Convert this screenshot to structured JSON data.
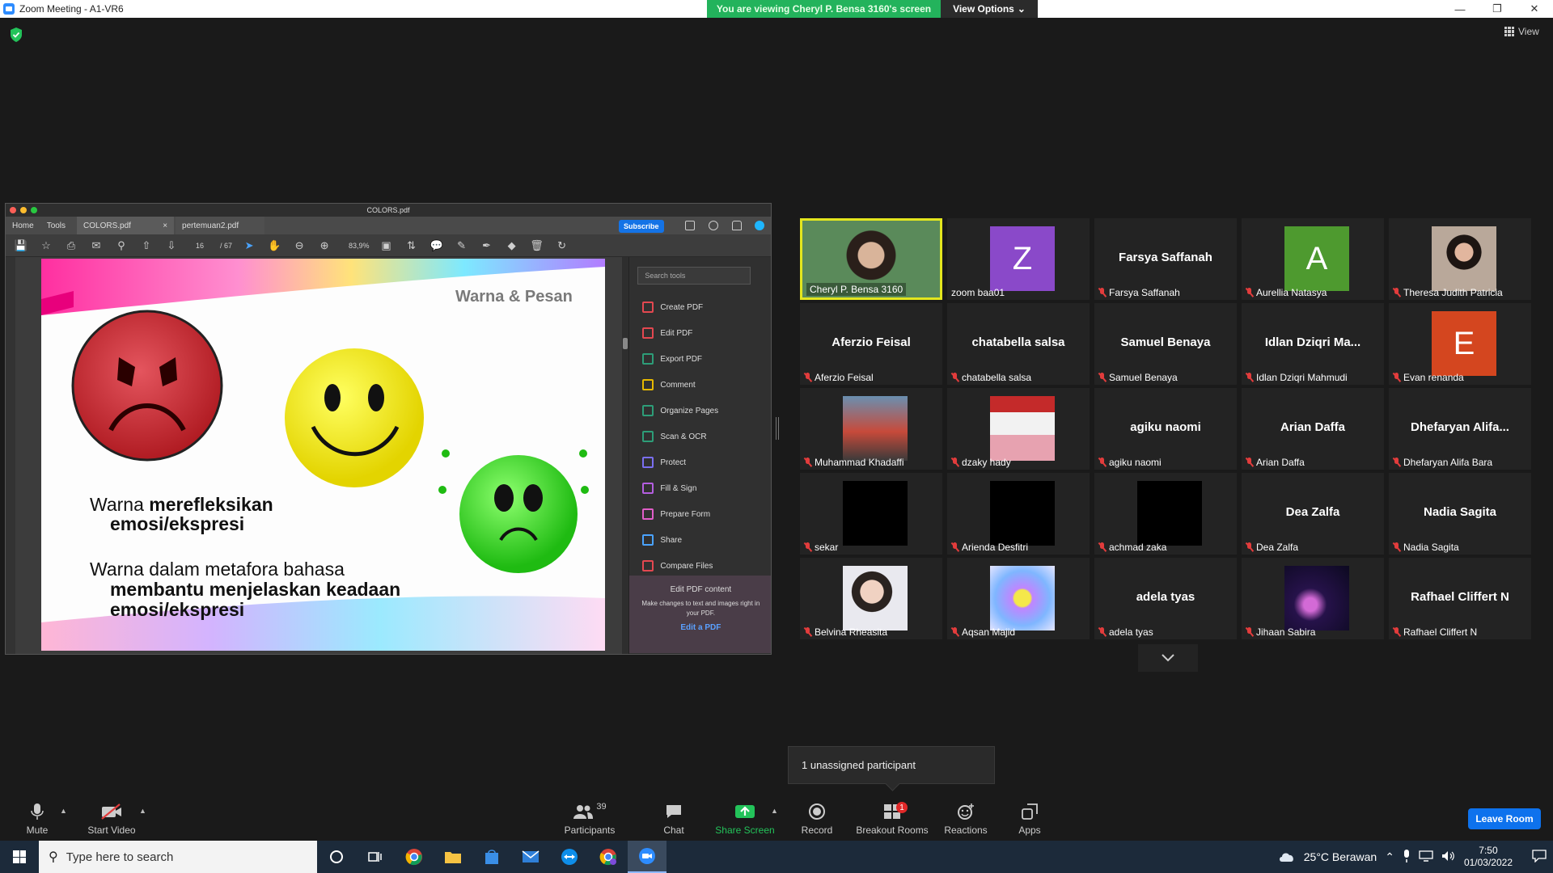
{
  "window": {
    "title": "Zoom Meeting - A1-VR6"
  },
  "banner": {
    "viewing": "You are viewing Cheryl P. Bensa 3160's screen",
    "view_options": "View Options"
  },
  "view_button": "View",
  "acrobat": {
    "title": "COLORS.pdf",
    "menu": [
      "Home",
      "Tools"
    ],
    "tabs": [
      "COLORS.pdf",
      "pertemuan2.pdf"
    ],
    "subscribe": "Subscribe",
    "page_current": "16",
    "page_total": "/ 67",
    "zoom": "83,9%",
    "search_placeholder": "Search tools",
    "tools": [
      {
        "label": "Create PDF",
        "color": "#e34850"
      },
      {
        "label": "Edit PDF",
        "color": "#e34850"
      },
      {
        "label": "Export PDF",
        "color": "#2d9d78"
      },
      {
        "label": "Comment",
        "color": "#e6b800"
      },
      {
        "label": "Organize Pages",
        "color": "#2d9d78"
      },
      {
        "label": "Scan & OCR",
        "color": "#2d9d78"
      },
      {
        "label": "Protect",
        "color": "#7a6ff0"
      },
      {
        "label": "Fill & Sign",
        "color": "#b45ee0"
      },
      {
        "label": "Prepare Form",
        "color": "#e05ec8"
      },
      {
        "label": "Share",
        "color": "#4aa3ff"
      },
      {
        "label": "Compare Files",
        "color": "#e34850"
      }
    ],
    "promo": {
      "heading": "Edit PDF content",
      "body": "Make changes to text and images right in your PDF.",
      "link": "Edit a PDF"
    }
  },
  "slide": {
    "title": "Warna & Pesan",
    "line1a": "Warna ",
    "line1b": "merefleksikan",
    "line2": "emosi/ekspresi",
    "line3": "Warna dalam metafora bahasa",
    "line4": "membantu menjelaskan keadaan",
    "line5": "emosi/ekspresi"
  },
  "participants": [
    {
      "label": "Cheryl P. Bensa 3160",
      "kind": "photo",
      "muted": false,
      "active": true
    },
    {
      "label": "zoom baa01",
      "kind": "avatar",
      "letter": "Z",
      "color": "#8a49c9",
      "muted": false
    },
    {
      "label": "Farsya Saffanah",
      "kind": "name",
      "name": "Farsya Saffanah",
      "muted": true
    },
    {
      "label": "Aurellia Natasya",
      "kind": "avatar",
      "letter": "A",
      "color": "#4e9a2f",
      "muted": true
    },
    {
      "label": "Theresa Judith Patricia",
      "kind": "photo",
      "muted": true
    },
    {
      "label": "Aferzio Feisal",
      "kind": "name",
      "name": "Aferzio Feisal",
      "muted": true
    },
    {
      "label": "chatabella salsa",
      "kind": "name",
      "name": "chatabella salsa",
      "muted": true
    },
    {
      "label": "Samuel Benaya",
      "kind": "name",
      "name": "Samuel Benaya",
      "muted": true
    },
    {
      "label": "Idlan Dziqri Mahmudi",
      "kind": "name",
      "name": "Idlan  Dziqri  Ma...",
      "muted": true
    },
    {
      "label": "Evan renanda",
      "kind": "avatar",
      "letter": "E",
      "color": "#d4461f",
      "muted": true
    },
    {
      "label": "Muhammad Khadaffi",
      "kind": "photo",
      "muted": true
    },
    {
      "label": "dzaky hady",
      "kind": "photo",
      "muted": true
    },
    {
      "label": "agiku naomi",
      "kind": "name",
      "name": "agiku naomi",
      "muted": true
    },
    {
      "label": "Arian Daffa",
      "kind": "name",
      "name": "Arian Daffa",
      "muted": true
    },
    {
      "label": "Dhefaryan Alifa Bara",
      "kind": "name",
      "name": "Dhefaryan  Alifa...",
      "muted": true
    },
    {
      "label": "sekar",
      "kind": "black",
      "muted": true
    },
    {
      "label": "Arienda Desfitri",
      "kind": "black",
      "muted": true
    },
    {
      "label": "achmad zaka",
      "kind": "black",
      "muted": true
    },
    {
      "label": "Dea Zalfa",
      "kind": "name",
      "name": "Dea Zalfa",
      "muted": true
    },
    {
      "label": "Nadia Sagita",
      "kind": "name",
      "name": "Nadia Sagita",
      "muted": true
    },
    {
      "label": "Belvina Rheasita",
      "kind": "photo",
      "muted": true
    },
    {
      "label": "Aqsan Majid",
      "kind": "photo",
      "muted": true
    },
    {
      "label": "adela tyas",
      "kind": "name",
      "name": "adela tyas",
      "muted": true
    },
    {
      "label": "Jihaan Sabira",
      "kind": "photo",
      "muted": true
    },
    {
      "label": "Rafhael Cliffert N",
      "kind": "name",
      "name": "Rafhael Cliffert N",
      "muted": true
    }
  ],
  "unassigned": "1 unassigned participant",
  "toolbar": {
    "mute": "Mute",
    "start_video": "Start Video",
    "participants": "Participants",
    "participant_count": "39",
    "chat": "Chat",
    "share_screen": "Share Screen",
    "record": "Record",
    "breakout_rooms": "Breakout Rooms",
    "breakout_badge": "1",
    "reactions": "Reactions",
    "apps": "Apps",
    "leave": "Leave Room"
  },
  "taskbar": {
    "search_placeholder": "Type here to search",
    "weather": "25°C  Berawan",
    "time": "7:50",
    "date": "01/03/2022"
  }
}
